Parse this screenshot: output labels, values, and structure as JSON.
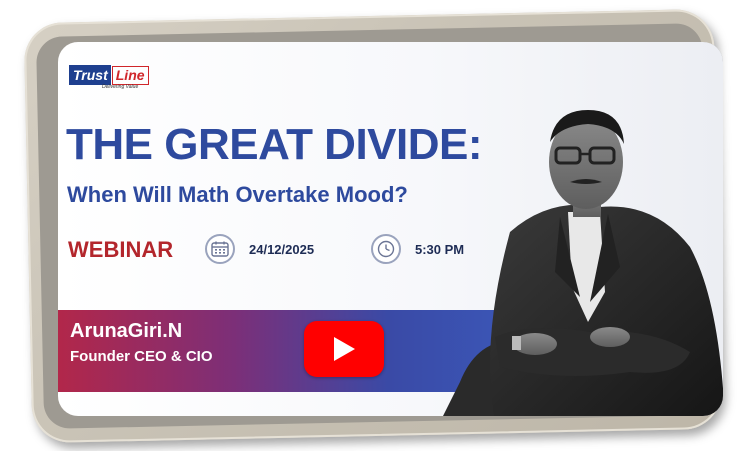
{
  "logo": {
    "brand_part1": "Trust",
    "brand_part2": "Line",
    "tagline": "Delivering Value"
  },
  "headline": {
    "title": "THE GREAT DIVIDE:",
    "subtitle": "When Will Math Overtake Mood?"
  },
  "event": {
    "label": "WEBINAR",
    "date": "24/12/2025",
    "time": "5:30 PM",
    "date_icon": "calendar-icon",
    "time_icon": "clock-icon"
  },
  "speaker": {
    "name": "ArunaGiri.N",
    "role": "Founder CEO & CIO"
  },
  "video": {
    "play_icon": "youtube-play-icon"
  },
  "colors": {
    "title_blue": "#2e4a9e",
    "webinar_red": "#b3262c",
    "youtube_red": "#ff0000",
    "frame_beige": "#cfc9bd"
  }
}
